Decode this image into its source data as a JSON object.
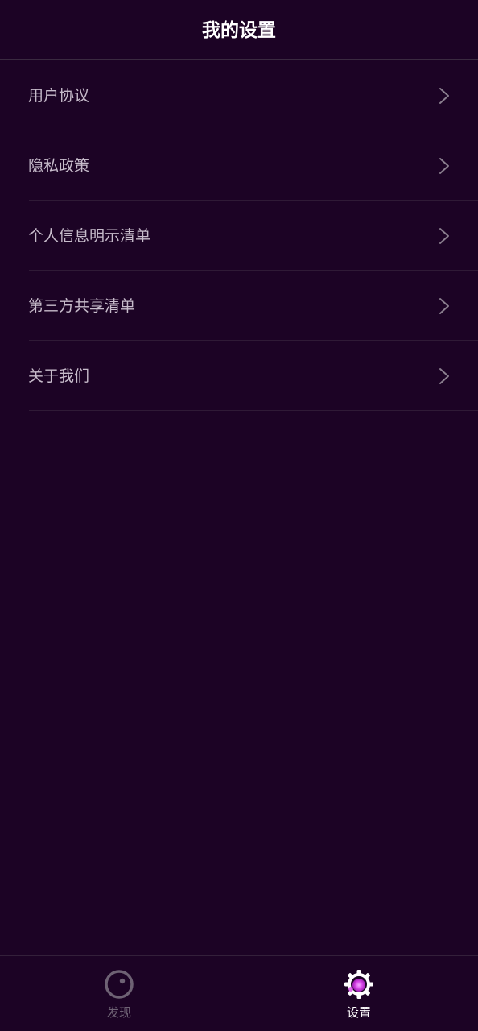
{
  "header": {
    "title": "我的设置"
  },
  "menu": {
    "items": [
      {
        "label": "用户协议",
        "icon": "chevron-right-icon"
      },
      {
        "label": "隐私政策",
        "icon": "chevron-right-icon"
      },
      {
        "label": "个人信息明示清单",
        "icon": "chevron-right-icon"
      },
      {
        "label": "第三方共享清单",
        "icon": "chevron-right-icon"
      },
      {
        "label": "关于我们",
        "icon": "chevron-right-icon"
      }
    ]
  },
  "tabbar": {
    "tabs": [
      {
        "label": "发现",
        "icon": "discover-icon",
        "active": false
      },
      {
        "label": "设置",
        "icon": "gear-icon",
        "active": true
      }
    ]
  },
  "colors": {
    "background": "#1c0325",
    "accent": "#d846e8",
    "inactive": "#6e6274",
    "text": "#c7bccb"
  }
}
